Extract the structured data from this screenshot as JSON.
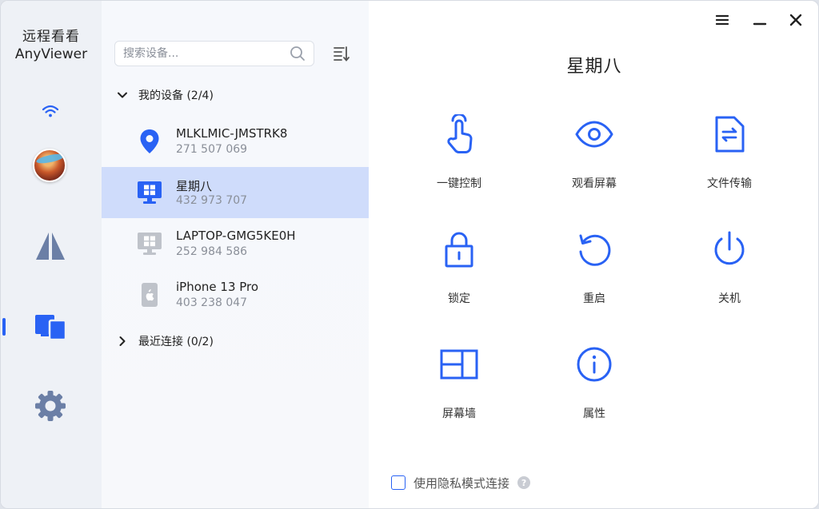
{
  "app": {
    "brand_cn": "远程看看",
    "brand_en": "AnyViewer",
    "accent": "#2962f4"
  },
  "rail": {
    "items": [
      {
        "name": "wifi-icon"
      },
      {
        "name": "avatar"
      },
      {
        "name": "connect-icon"
      },
      {
        "name": "devices-icon",
        "active": true
      },
      {
        "name": "gear-icon"
      }
    ]
  },
  "search": {
    "placeholder": "搜索设备..."
  },
  "groups": [
    {
      "label": "我的设备 (2/4)",
      "expanded": true
    },
    {
      "label": "最近连接 (0/2)",
      "expanded": false
    }
  ],
  "devices": [
    {
      "name": "MLKLMIC-JMSTRK8",
      "id": "271 507 069",
      "icon": "location-pin-icon",
      "selected": false
    },
    {
      "name": "星期八",
      "id": "432 973 707",
      "icon": "windows-pc-icon",
      "selected": true
    },
    {
      "name": "LAPTOP-GMG5KE0H",
      "id": "252 984 586",
      "icon": "windows-pc-icon",
      "selected": false
    },
    {
      "name": "iPhone 13 Pro",
      "id": "403 238 047",
      "icon": "iphone-icon",
      "selected": false
    }
  ],
  "main": {
    "title": "星期八",
    "actions": [
      {
        "label": "一键控制",
        "icon": "tap-control-icon"
      },
      {
        "label": "观看屏幕",
        "icon": "eye-icon"
      },
      {
        "label": "文件传输",
        "icon": "file-transfer-icon"
      },
      {
        "label": "锁定",
        "icon": "lock-icon"
      },
      {
        "label": "重启",
        "icon": "restart-icon"
      },
      {
        "label": "关机",
        "icon": "power-icon"
      },
      {
        "label": "屏幕墙",
        "icon": "screen-wall-icon"
      },
      {
        "label": "属性",
        "icon": "info-icon"
      }
    ],
    "privacy_label": "使用隐私模式连接",
    "privacy_checked": false
  }
}
